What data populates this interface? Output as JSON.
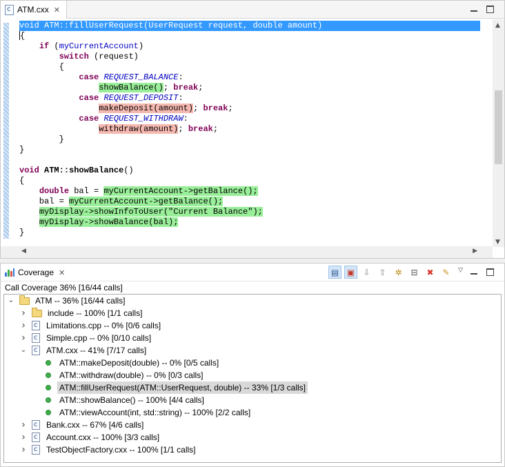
{
  "editor": {
    "tab_label": "ATM.cxx",
    "lines": [
      {
        "selected": true,
        "segs": [
          {
            "t": "void ATM::fillUserRequest(UserRequest request, double amount)"
          }
        ]
      },
      {
        "segs": [
          {
            "t": "{"
          }
        ]
      },
      {
        "segs": [
          {
            "t": "    "
          },
          {
            "t": "if",
            "c": "kw"
          },
          {
            "t": " ("
          },
          {
            "t": "myCurrentAccount",
            "c": "id"
          },
          {
            "t": ")"
          }
        ]
      },
      {
        "segs": [
          {
            "t": "        "
          },
          {
            "t": "switch",
            "c": "kw"
          },
          {
            "t": " (request)"
          }
        ]
      },
      {
        "segs": [
          {
            "t": "        {"
          }
        ]
      },
      {
        "segs": [
          {
            "t": "            "
          },
          {
            "t": "case",
            "c": "kw"
          },
          {
            "t": " "
          },
          {
            "t": "REQUEST_BALANCE",
            "c": "en"
          },
          {
            "t": ":"
          }
        ]
      },
      {
        "segs": [
          {
            "t": "                "
          },
          {
            "t": "showBalance()",
            "c": "hl-green"
          },
          {
            "t": "; "
          },
          {
            "t": "break",
            "c": "kw"
          },
          {
            "t": ";"
          }
        ]
      },
      {
        "segs": [
          {
            "t": "            "
          },
          {
            "t": "case",
            "c": "kw"
          },
          {
            "t": " "
          },
          {
            "t": "REQUEST_DEPOSIT",
            "c": "en"
          },
          {
            "t": ":"
          }
        ]
      },
      {
        "segs": [
          {
            "t": "                "
          },
          {
            "t": "makeDeposit(amount)",
            "c": "hl-red"
          },
          {
            "t": "; "
          },
          {
            "t": "break",
            "c": "kw"
          },
          {
            "t": ";"
          }
        ]
      },
      {
        "segs": [
          {
            "t": "            "
          },
          {
            "t": "case",
            "c": "kw"
          },
          {
            "t": " "
          },
          {
            "t": "REQUEST_WITHDRAW",
            "c": "en"
          },
          {
            "t": ":"
          }
        ]
      },
      {
        "segs": [
          {
            "t": "                "
          },
          {
            "t": "withdraw(amount)",
            "c": "hl-red"
          },
          {
            "t": "; "
          },
          {
            "t": "break",
            "c": "kw"
          },
          {
            "t": ";"
          }
        ]
      },
      {
        "segs": [
          {
            "t": "        }"
          }
        ]
      },
      {
        "segs": [
          {
            "t": "}"
          }
        ]
      },
      {
        "segs": [
          {
            "t": ""
          }
        ]
      },
      {
        "segs": [
          {
            "t": "void",
            "c": "kw"
          },
          {
            "t": " "
          },
          {
            "t": "ATM::showBalance",
            "c": "fn"
          },
          {
            "t": "()"
          }
        ]
      },
      {
        "segs": [
          {
            "t": "{"
          }
        ]
      },
      {
        "segs": [
          {
            "t": "    "
          },
          {
            "t": "double",
            "c": "kw"
          },
          {
            "t": " bal = "
          },
          {
            "t": "myCurrentAccount->getBalance();",
            "c": "hl-green"
          }
        ]
      },
      {
        "segs": [
          {
            "t": "    bal = "
          },
          {
            "t": "myCurrentAccount->getBalance();",
            "c": "hl-green"
          }
        ]
      },
      {
        "segs": [
          {
            "t": "    "
          },
          {
            "t": "myDisplay->showInfoToUser(\"Current Balance\");",
            "c": "hl-green"
          }
        ]
      },
      {
        "segs": [
          {
            "t": "    "
          },
          {
            "t": "myDisplay->showBalance(bal);",
            "c": "hl-green"
          }
        ]
      },
      {
        "segs": [
          {
            "t": "}"
          }
        ]
      }
    ]
  },
  "coverage": {
    "tab_label": "Coverage",
    "summary": "Call Coverage 36% [16/44 calls]",
    "toolbar_icons": [
      "show-files-icon",
      "show-functions-icon",
      "next-down-icon",
      "next-up-icon",
      "settings-icon",
      "collapse-all-icon",
      "remove-icon",
      "merge-icon"
    ],
    "tree": [
      {
        "level": 0,
        "twisty": "open",
        "icon": "folder",
        "label": "ATM -- 36% [16/44 calls]"
      },
      {
        "level": 1,
        "twisty": "closed",
        "icon": "folder",
        "label": "include -- 100% [1/1 calls]"
      },
      {
        "level": 1,
        "twisty": "closed",
        "icon": "source",
        "label": "Limitations.cpp -- 0% [0/6 calls]"
      },
      {
        "level": 1,
        "twisty": "closed",
        "icon": "source",
        "label": "Simple.cpp -- 0% [0/10 calls]"
      },
      {
        "level": 1,
        "twisty": "open",
        "icon": "source",
        "label": "ATM.cxx -- 41% [7/17 calls]"
      },
      {
        "level": 2,
        "twisty": "none",
        "icon": "function",
        "label": "ATM::makeDeposit(double) -- 0% [0/5 calls]"
      },
      {
        "level": 2,
        "twisty": "none",
        "icon": "function",
        "label": "ATM::withdraw(double) -- 0% [0/3 calls]"
      },
      {
        "level": 2,
        "twisty": "none",
        "icon": "function",
        "label": "ATM::fillUserRequest(ATM::UserRequest, double) -- 33% [1/3 calls]",
        "selected": true
      },
      {
        "level": 2,
        "twisty": "none",
        "icon": "function",
        "label": "ATM::showBalance() -- 100% [4/4 calls]"
      },
      {
        "level": 2,
        "twisty": "none",
        "icon": "function",
        "label": "ATM::viewAccount(int, std::string) -- 100% [2/2 calls]"
      },
      {
        "level": 1,
        "twisty": "closed",
        "icon": "source",
        "label": "Bank.cxx -- 67% [4/6 calls]"
      },
      {
        "level": 1,
        "twisty": "closed",
        "icon": "source",
        "label": "Account.cxx -- 100% [3/3 calls]"
      },
      {
        "level": 1,
        "twisty": "closed",
        "icon": "source",
        "label": "TestObjectFactory.cxx -- 100% [1/1 calls]"
      }
    ]
  }
}
